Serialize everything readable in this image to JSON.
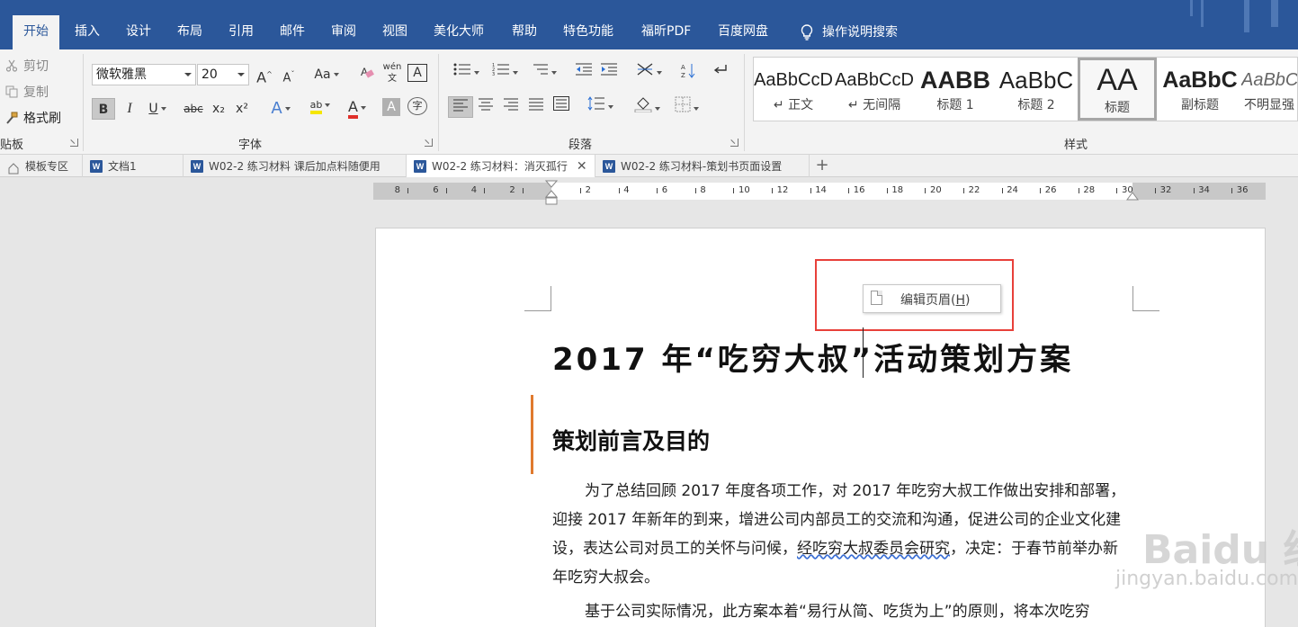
{
  "menu": {
    "tabs": [
      "开始",
      "插入",
      "设计",
      "布局",
      "引用",
      "邮件",
      "审阅",
      "视图",
      "美化大师",
      "帮助",
      "特色功能",
      "福昕PDF",
      "百度网盘"
    ],
    "active_tab": "开始",
    "search_label": "操作说明搜索"
  },
  "ribbon": {
    "clipboard": {
      "cut": "剪切",
      "copy": "复制",
      "format_painter": "格式刷",
      "group_label": "贴板"
    },
    "font": {
      "font_name": "微软雅黑",
      "font_size": "20",
      "grow": "A",
      "shrink": "A",
      "change_case": "Aa",
      "phonetic": "wén 文",
      "border_char": "A",
      "bold": "B",
      "italic": "I",
      "underline": "U",
      "strikethrough": "abc",
      "subscript": "x₂",
      "superscript": "x²",
      "text_effect": "A",
      "highlight": "ab",
      "font_color": "A",
      "shading": "A",
      "enclose": "字",
      "group_label": "字体"
    },
    "paragraph": {
      "group_label": "段落"
    },
    "styles": {
      "group_label": "样式",
      "items": [
        {
          "sample": "AaBbCcD",
          "name": "↵ 正文"
        },
        {
          "sample": "AaBbCcD",
          "name": "↵ 无间隔"
        },
        {
          "sample": "AABB",
          "name": "标题 1"
        },
        {
          "sample": "AaBbC",
          "name": "标题 2"
        },
        {
          "sample": "AA",
          "name": "标题"
        },
        {
          "sample": "AaBbC",
          "name": "副标题"
        },
        {
          "sample": "AaBbCc",
          "name": "不明显强"
        }
      ]
    }
  },
  "doc_tabs": [
    {
      "label": "模板专区"
    },
    {
      "label": "文档1"
    },
    {
      "label": "W02-2 练习材料 课后加点料随便用"
    },
    {
      "label": "W02-2 练习材料：消灭孤行"
    },
    {
      "label": "W02-2 练习材料-策划书页面设置"
    }
  ],
  "ruler": {
    "left_numbers": [
      "8",
      "6",
      "4",
      "2"
    ],
    "right_numbers": [
      "2",
      "4",
      "6",
      "8",
      "10",
      "12",
      "14",
      "16",
      "18",
      "20",
      "22",
      "24",
      "26",
      "28",
      "30",
      "32",
      "34",
      "36"
    ]
  },
  "document": {
    "edit_header_label": "编辑页眉(H)",
    "edit_header_text": "编辑页眉(",
    "edit_header_key": "H",
    "edit_header_close": ")",
    "title": "2017 年“吃穷大叔”活动策划方案",
    "heading": "策划前言及目的",
    "para1_a": "为了总结回顾 2017 年度各项工作，对 2017 年吃穷大叔工作做出安排和部署，迎接 2017 年新年的到来，增进公司内部员工的交流和沟通，促进公司的企业文化建设，表达公司对员工的关怀与问候，",
    "para1_b": "经吃穷大叔委员会研究",
    "para1_c": "，决定：于春节前举办新年吃穷大叔会。",
    "para2": "基于公司实际情况，此方案本着“易行从简、吃货为上”的原则，将本次吃穷"
  },
  "watermark": {
    "big": "Baidu 经验",
    "small": "jingyan.baidu.com"
  },
  "colors": {
    "menubar": "#2b579a",
    "highlight_box": "#e8403a",
    "accent_bar": "#e07a2e"
  }
}
